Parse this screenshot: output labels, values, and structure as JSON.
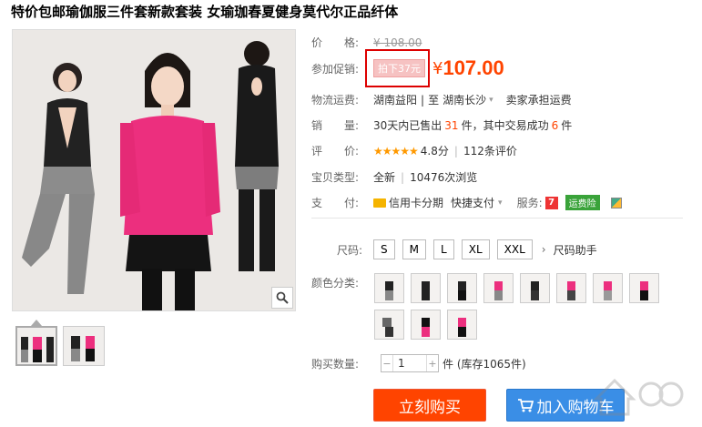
{
  "title": "特价包邮瑜伽服三件套新款套装 女瑜珈春夏健身莫代尔正品纤体",
  "price": {
    "label": "价　　格:",
    "original": "¥ 108.00"
  },
  "promo": {
    "label": "参加促销:",
    "tag": "拍下37元",
    "yen": "¥",
    "value": "107.00"
  },
  "shipping": {
    "label": "物流运费:",
    "from": "湖南益阳",
    "sep": "|",
    "to_prefix": "至",
    "to": "湖南长沙",
    "note": "卖家承担运费"
  },
  "sales": {
    "label": "销　　量:",
    "pre": "30天内已售出",
    "count": "31",
    "mid": "件，其中交易成功",
    "success": "6",
    "post": "件"
  },
  "rating": {
    "label": "评　　价:",
    "stars": "★★★★★",
    "score": "4.8分",
    "sep": "|",
    "reviews": "112条评价"
  },
  "type": {
    "label": "宝贝类型:",
    "value": "全新",
    "sep": "|",
    "views": "10476次浏览"
  },
  "pay": {
    "label": "支　　付:",
    "credit": "信用卡分期",
    "quick": "快捷支付",
    "service_label": "服务:",
    "service_badge": "运费险"
  },
  "size": {
    "label": "尺码:",
    "options": [
      "S",
      "M",
      "L",
      "XL",
      "XXL"
    ],
    "helper": "尺码助手"
  },
  "color": {
    "label": "颜色分类:"
  },
  "quantity": {
    "label": "购买数量:",
    "value": "1",
    "unit": "件 (库存1065件)"
  },
  "actions": {
    "buy": "立刻购买",
    "cart": "加入购物车"
  },
  "colors": {
    "accent": "#ff4400",
    "cart_blue": "#3a8ee6",
    "pink_top": "#ec2f7e",
    "black_top": "#222222"
  }
}
